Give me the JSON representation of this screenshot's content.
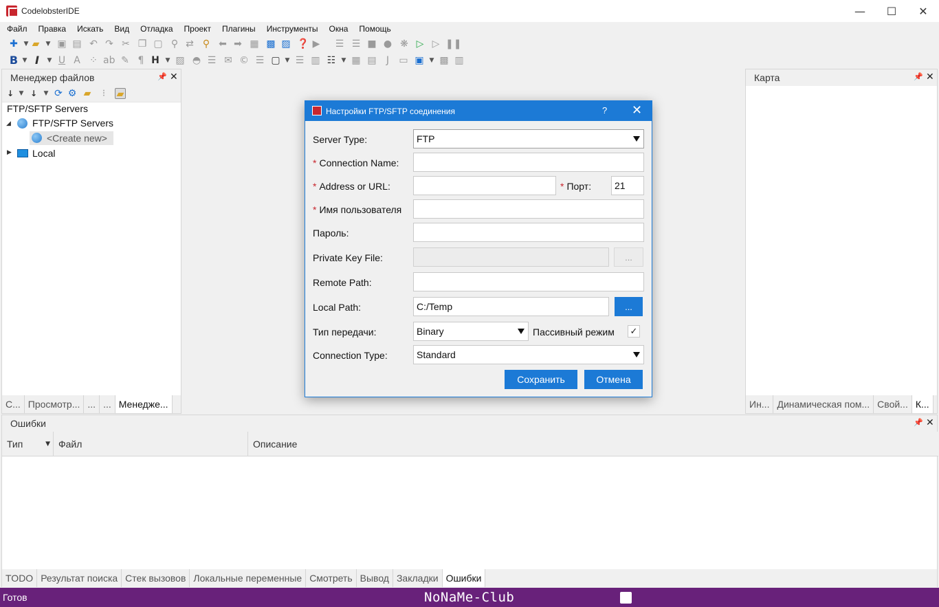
{
  "window": {
    "title": "CodelobsterIDE",
    "minimize": "—",
    "maximize": "☐",
    "close": "✕"
  },
  "menu": [
    "Файл",
    "Правка",
    "Искать",
    "Вид",
    "Отладка",
    "Проект",
    "Плагины",
    "Инструменты",
    "Окна",
    "Помощь"
  ],
  "file_manager": {
    "title": "Менеджер файлов",
    "root_label": "FTP/SFTP Servers",
    "ftp_node": "FTP/SFTP Servers",
    "create_new": "<Create new>",
    "local_node": "Local",
    "tabs": [
      "C...",
      "Просмотр...",
      "...",
      "...",
      "Менедже..."
    ]
  },
  "map_panel": {
    "title": "Карта",
    "tabs": [
      "Ин...",
      "Динамическая пом...",
      "Свой...",
      "К..."
    ]
  },
  "errors_panel": {
    "title": "Ошибки",
    "columns": [
      "Тип",
      "Файл",
      "Описание"
    ]
  },
  "bottom_tabs": [
    "TODO",
    "Результат поиска",
    "Стек вызовов",
    "Локальные переменные",
    "Смотреть",
    "Вывод",
    "Закладки",
    "Ошибки"
  ],
  "status": {
    "text": "Готов",
    "watermark": "NoNaMe-Club"
  },
  "dialog": {
    "title": "Настройки FTP/SFTP соединения",
    "help": "?",
    "close": "✕",
    "server_type_label": "Server Type:",
    "server_type_value": "FTP",
    "connection_name_label": "Connection Name:",
    "connection_name_value": "",
    "address_label": "Address or URL:",
    "address_value": "",
    "port_label": "Порт:",
    "port_value": "21",
    "username_label": "Имя пользователя",
    "username_value": "",
    "password_label": "Пароль:",
    "password_value": "",
    "private_key_label": "Private Key File:",
    "private_key_value": "",
    "private_key_browse": "...",
    "remote_path_label": "Remote Path:",
    "remote_path_value": "",
    "local_path_label": "Local Path:",
    "local_path_value": "C:/Temp",
    "local_path_browse": "...",
    "transfer_label": "Тип передачи:",
    "transfer_value": "Binary",
    "passive_label": "Пассивный режим",
    "passive_checked": "✓",
    "connection_type_label": "Connection Type:",
    "connection_type_value": "Standard",
    "required_mark": "*",
    "save": "Сохранить",
    "cancel": "Отмена"
  },
  "colors": {
    "accent": "#1c7ad6",
    "status_bar": "#68217a",
    "required": "#c8262e"
  }
}
